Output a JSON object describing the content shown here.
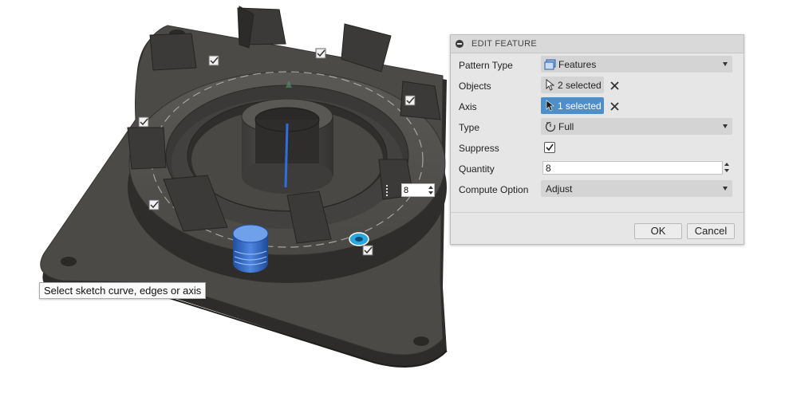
{
  "panel": {
    "title": "EDIT FEATURE",
    "rows": {
      "pattern_type": {
        "label": "Pattern Type",
        "value": "Features",
        "icon": "features-icon"
      },
      "objects": {
        "label": "Objects",
        "value": "2 selected",
        "icon": "cursor-arrow-icon"
      },
      "axis": {
        "label": "Axis",
        "value": "1 selected",
        "icon": "cursor-arrow-icon",
        "active_color": "#4e8fc9"
      },
      "type": {
        "label": "Type",
        "value": "Full",
        "icon": "circular-pattern-icon"
      },
      "suppress": {
        "label": "Suppress",
        "checked": true
      },
      "quantity": {
        "label": "Quantity",
        "value": "8"
      },
      "compute_option": {
        "label": "Compute Option",
        "value": "Adjust"
      }
    },
    "ok_label": "OK",
    "cancel_label": "Cancel"
  },
  "viewport": {
    "tooltip": "Select sketch curve, edges or axis",
    "inline_quantity": "8",
    "model_color": "#4a4846",
    "selection_color": "#2f6fd8"
  }
}
